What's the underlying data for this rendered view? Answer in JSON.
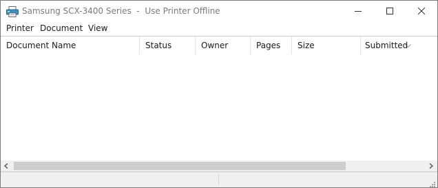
{
  "window": {
    "title": "Samsung SCX-3400 Series  -  Use Printer Offline"
  },
  "icons": {
    "app": "printer-icon",
    "minimize": "minimize-icon",
    "maximize": "maximize-icon",
    "close": "close-icon",
    "sort": "sort-descending-icon",
    "scroll_left": "scroll-left-arrow-icon",
    "scroll_right": "scroll-right-arrow-icon"
  },
  "menu": {
    "items": [
      {
        "label": "Printer"
      },
      {
        "label": "Document"
      },
      {
        "label": "View"
      }
    ]
  },
  "table": {
    "columns": [
      {
        "label": "Document Name"
      },
      {
        "label": "Status"
      },
      {
        "label": "Owner"
      },
      {
        "label": "Pages"
      },
      {
        "label": "Size"
      },
      {
        "label": "Submitted"
      }
    ],
    "rows": []
  },
  "scrollbar": {
    "horizontal_visible_fraction": 0.8
  },
  "colors": {
    "title_text": "#7a7a7a",
    "scroll_thumb": "#cdcdcd",
    "statusbar_bg": "#f0f0f0"
  }
}
